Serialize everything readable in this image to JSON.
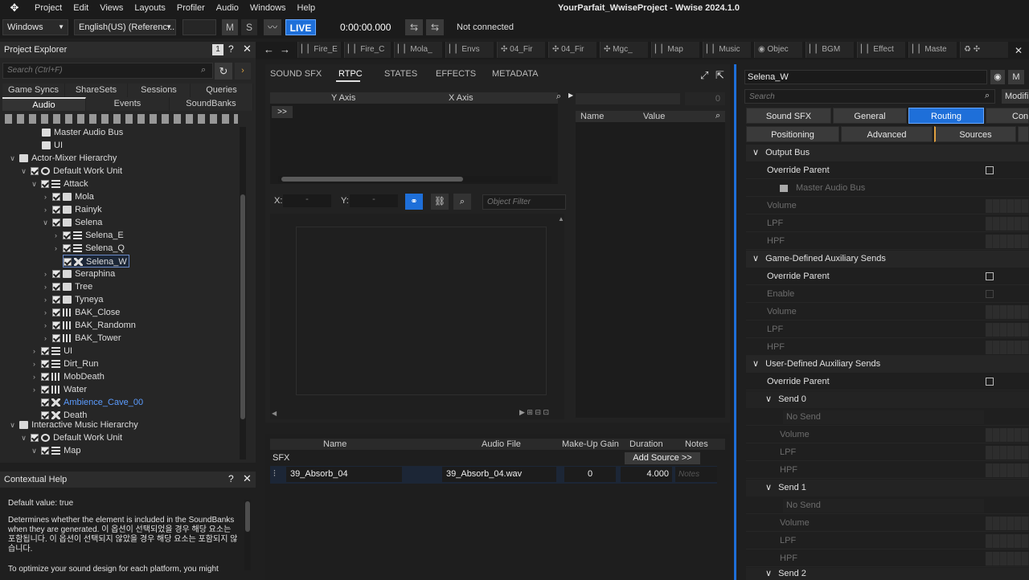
{
  "app": {
    "title": "YourParfait_WwiseProject - Wwise 2024.1.0",
    "menu": [
      "Project",
      "Edit",
      "Views",
      "Layouts",
      "Profiler",
      "Audio",
      "Windows",
      "Help"
    ]
  },
  "toolbar": {
    "platform": "Windows",
    "language": "English(US) (Referenc...",
    "mute": "M",
    "solo": "S",
    "live": "LIVE",
    "time": "0:00:00.000",
    "connection": "Not connected"
  },
  "explorer": {
    "title": "Project Explorer",
    "badge": "1",
    "search_placeholder": "Search (Ctrl+F)",
    "tabs_top": [
      "Game Syncs",
      "ShareSets",
      "Sessions",
      "Queries"
    ],
    "tabs_bottom": [
      "Audio",
      "Events",
      "SoundBanks"
    ],
    "tree": [
      {
        "label": "Master Audio Bus",
        "icon": "bus-icon"
      },
      {
        "label": "UI",
        "icon": "bus-icon"
      },
      {
        "label": "Actor-Mixer Hierarchy",
        "icon": "folder-icon"
      },
      {
        "label": "Default Work Unit",
        "icon": "work-unit-icon"
      },
      {
        "label": "Attack",
        "icon": "actor-mixer-icon"
      },
      {
        "label": "Mola",
        "icon": "folder-icon"
      },
      {
        "label": "Rainyk",
        "icon": "folder-icon"
      },
      {
        "label": "Selena",
        "icon": "folder-icon"
      },
      {
        "label": "Selena_E",
        "icon": "container-icon"
      },
      {
        "label": "Selena_Q",
        "icon": "container-icon"
      },
      {
        "label": "Selena_W",
        "icon": "sound-icon"
      },
      {
        "label": "Seraphina",
        "icon": "folder-icon"
      },
      {
        "label": "Tree",
        "icon": "folder-icon"
      },
      {
        "label": "Tyneya",
        "icon": "folder-icon"
      },
      {
        "label": "BAK_Close",
        "icon": "random-container-icon"
      },
      {
        "label": "BAK_Randomn",
        "icon": "random-container-icon"
      },
      {
        "label": "BAK_Tower",
        "icon": "random-container-icon"
      },
      {
        "label": "UI",
        "icon": "actor-mixer-icon"
      },
      {
        "label": "Dirt_Run",
        "icon": "container-icon"
      },
      {
        "label": "MobDeath",
        "icon": "random-container-icon"
      },
      {
        "label": "Water",
        "icon": "random-container-icon"
      },
      {
        "label": "Ambience_Cave_00",
        "icon": "sound-icon"
      },
      {
        "label": "Death",
        "icon": "sound-icon"
      },
      {
        "label": "Interactive Music Hierarchy",
        "icon": "folder-icon"
      },
      {
        "label": "Default Work Unit",
        "icon": "work-unit-icon"
      },
      {
        "label": "Map",
        "icon": "container-icon"
      }
    ]
  },
  "help": {
    "title": "Contextual Help",
    "default": "Default value: true",
    "body": "Determines whether the element is included in the SoundBanks when they are generated. 이 옵션이 선택되었을 경우 해당 요소는 포함됩니다. 이 옵션이 선택되지 않았을 경우 해당 요소는 포함되지 않습니다.",
    "more": "To optimize your sound design for each platform, you might"
  },
  "nav_tabs": [
    "Fire_E",
    "Fire_C",
    "Mola_",
    "Envs",
    "04_Fir",
    "04_Fir",
    "Mgc_",
    "Map",
    "Music",
    "Objec",
    "BGM",
    "Effect",
    "Maste"
  ],
  "editor": {
    "tabs": [
      "SOUND SFX",
      "RTPC",
      "STATES",
      "EFFECTS",
      "METADATA"
    ],
    "rtpc_cols": [
      "Y Axis",
      "X Axis"
    ],
    "expand": ">>",
    "x_label": "X:",
    "x_value": "-",
    "y_label": "Y:",
    "y_value": "-",
    "object_filter": "Object Filter",
    "name_col": "Name",
    "value_col": "Value",
    "count": "0"
  },
  "sources": {
    "columns": [
      "Name",
      "Audio File",
      "Make-Up Gain",
      "Duration",
      "Notes"
    ],
    "group": "SFX",
    "add_source": "Add Source >>",
    "row": {
      "name": "39_Absorb_04",
      "file": "39_Absorb_04.wav",
      "gain": "0",
      "duration": "4.000",
      "notes": "Notes"
    }
  },
  "props": {
    "object_name": "Selena_W",
    "mode": "M",
    "search_placeholder": "Search",
    "modifier": "Modifi",
    "tabs_row1": [
      "Sound SFX",
      "General",
      "Routing",
      "Conv"
    ],
    "tabs_row2": [
      "Positioning",
      "Advanced",
      "Sources"
    ],
    "output_bus": "Output Bus",
    "override_parent": "Override Parent",
    "master_bus": "Master Audio Bus",
    "volume": "Volume",
    "lpf": "LPF",
    "hpf": "HPF",
    "game_aux": "Game-Defined Auxiliary Sends",
    "enable": "Enable",
    "user_aux": "User-Defined Auxiliary Sends",
    "send0": "Send 0",
    "send1": "Send 1",
    "send2": "Send 2",
    "no_send": "No Send"
  },
  "colors": {
    "accent": "#1e6fd9",
    "panel": "#262626",
    "bg": "#1f1f1f",
    "link": "#5b9cff"
  }
}
